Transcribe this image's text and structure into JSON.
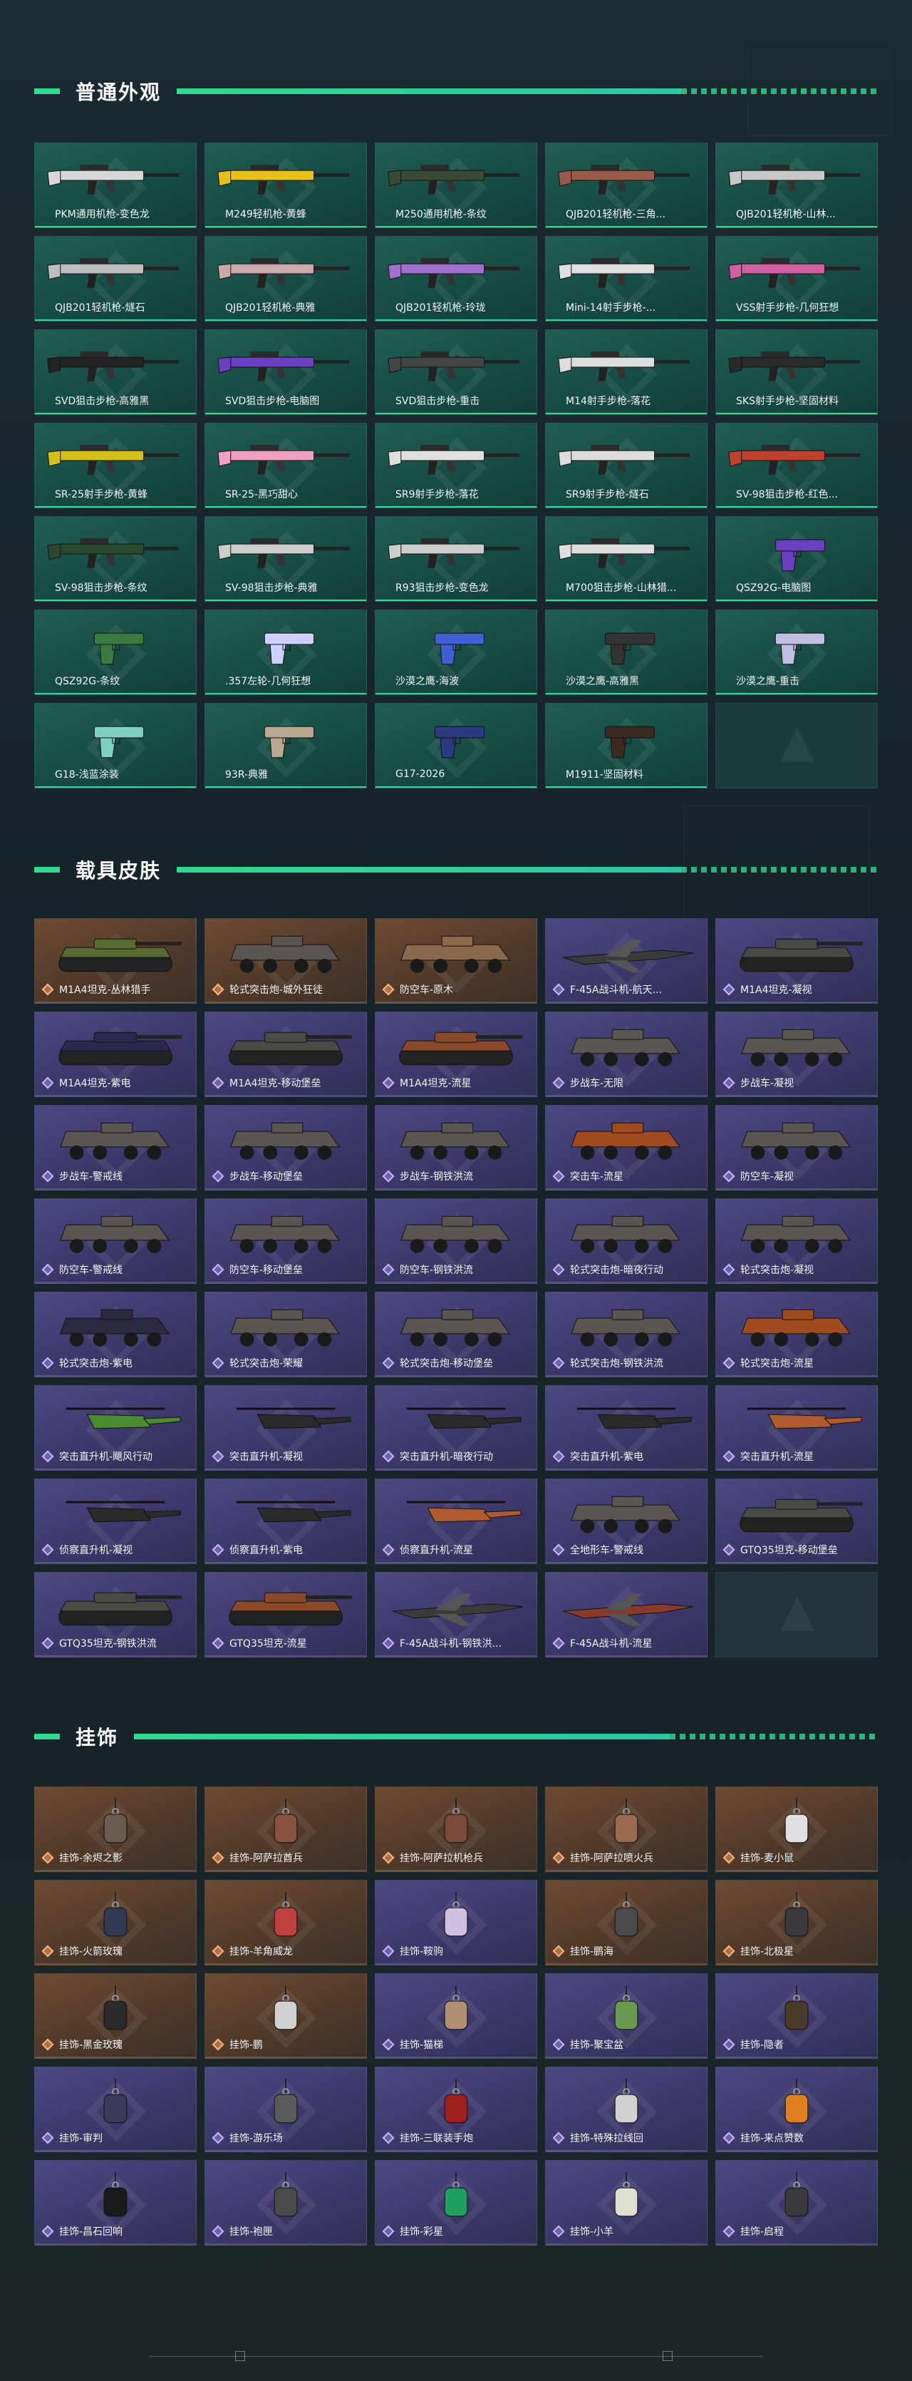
{
  "sections": {
    "weapons": {
      "title": "普通外观",
      "items": [
        "PKM通用机枪-变色龙",
        "M249轻机枪-黄蜂",
        "M250通用机枪-条纹",
        "QJB201轻机枪-三角...",
        "QJB201轻机枪-山林...",
        "QJB201轻机枪-燧石",
        "QJB201轻机枪-典雅",
        "QJB201轻机枪-玲珑",
        "Mini-14射手步枪-...",
        "VSS射手步枪-几何狂想",
        "SVD狙击步枪-高雅黑",
        "SVD狙击步枪-电脑图",
        "SVD狙击步枪-重击",
        "M14射手步枪-落花",
        "SKS射手步枪-坚固材料",
        "SR-25射手步枪-黄蜂",
        "SR-25-黑巧甜心",
        "SR9射手步枪-落花",
        "SR9射手步枪-燧石",
        "SV-98狙击步枪-红色...",
        "SV-98狙击步枪-条纹",
        "SV-98狙击步枪-典雅",
        "R93狙击步枪-变色龙",
        "M700狙击步枪-山林猎...",
        "QSZ92G-电脑图",
        "QSZ92G-条纹",
        ".357左轮-几何狂想",
        "沙漠之鹰-海波",
        "沙漠之鹰-高雅黑",
        "沙漠之鹰-重击",
        "G18-浅蓝涂装",
        "93R-典雅",
        "G17-2026",
        "M1911-坚固材料"
      ]
    },
    "vehicles": {
      "title": "载具皮肤",
      "items": [
        {
          "label": "M1A4坦克-丛林猎手",
          "tone": "orange"
        },
        {
          "label": "轮式突击炮-城外狂徒",
          "tone": "orange"
        },
        {
          "label": "防空车-原木",
          "tone": "orange"
        },
        {
          "label": "F-45A战斗机-航天...",
          "tone": "purple"
        },
        {
          "label": "M1A4坦克-凝视",
          "tone": "purple"
        },
        {
          "label": "M1A4坦克-紫电",
          "tone": "purple"
        },
        {
          "label": "M1A4坦克-移动堡垒",
          "tone": "purple"
        },
        {
          "label": "M1A4坦克-流星",
          "tone": "purple"
        },
        {
          "label": "步战车-无限",
          "tone": "purple"
        },
        {
          "label": "步战车-凝视",
          "tone": "purple"
        },
        {
          "label": "步战车-警戒线",
          "tone": "purple"
        },
        {
          "label": "步战车-移动堡垒",
          "tone": "purple"
        },
        {
          "label": "步战车-钢铁洪流",
          "tone": "purple"
        },
        {
          "label": "突击车-流星",
          "tone": "purple"
        },
        {
          "label": "防空车-凝视",
          "tone": "purple"
        },
        {
          "label": "防空车-警戒线",
          "tone": "purple"
        },
        {
          "label": "防空车-移动堡垒",
          "tone": "purple"
        },
        {
          "label": "防空车-钢铁洪流",
          "tone": "purple"
        },
        {
          "label": "轮式突击炮-暗夜行动",
          "tone": "purple"
        },
        {
          "label": "轮式突击炮-凝视",
          "tone": "purple"
        },
        {
          "label": "轮式突击炮-紫电",
          "tone": "purple"
        },
        {
          "label": "轮式突击炮-荣耀",
          "tone": "purple"
        },
        {
          "label": "轮式突击炮-移动堡垒",
          "tone": "purple"
        },
        {
          "label": "轮式突击炮-钢铁洪流",
          "tone": "purple"
        },
        {
          "label": "轮式突击炮-流星",
          "tone": "purple"
        },
        {
          "label": "突击直升机-飓风行动",
          "tone": "purple"
        },
        {
          "label": "突击直升机-凝视",
          "tone": "purple"
        },
        {
          "label": "突击直升机-暗夜行动",
          "tone": "purple"
        },
        {
          "label": "突击直升机-紫电",
          "tone": "purple"
        },
        {
          "label": "突击直升机-流星",
          "tone": "purple"
        },
        {
          "label": "侦察直升机-凝视",
          "tone": "purple"
        },
        {
          "label": "侦察直升机-紫电",
          "tone": "purple"
        },
        {
          "label": "侦察直升机-流星",
          "tone": "purple"
        },
        {
          "label": "全地形车-警戒线",
          "tone": "purple"
        },
        {
          "label": "GTQ35坦克-移动堡垒",
          "tone": "purple"
        },
        {
          "label": "GTQ35坦克-钢铁洪流",
          "tone": "purple"
        },
        {
          "label": "GTQ35坦克-流星",
          "tone": "purple"
        },
        {
          "label": "F-45A战斗机-钢铁洪...",
          "tone": "purple"
        },
        {
          "label": "F-45A战斗机-流星",
          "tone": "purple"
        }
      ]
    },
    "pendants": {
      "title": "挂饰",
      "items": [
        {
          "label": "挂饰-余烬之影",
          "tone": "orange"
        },
        {
          "label": "挂饰-阿萨拉酋兵",
          "tone": "orange"
        },
        {
          "label": "挂饰-阿萨拉机枪兵",
          "tone": "orange"
        },
        {
          "label": "挂饰-阿萨拉喷火兵",
          "tone": "orange"
        },
        {
          "label": "挂饰-麦小鼠",
          "tone": "orange"
        },
        {
          "label": "挂饰-火箭玫瑰",
          "tone": "orange"
        },
        {
          "label": "挂饰-羊角威龙",
          "tone": "orange"
        },
        {
          "label": "挂饰-鞍驹",
          "tone": "purple"
        },
        {
          "label": "挂饰-鹏海",
          "tone": "orange"
        },
        {
          "label": "挂饰-北极星",
          "tone": "orange"
        },
        {
          "label": "挂饰-黑金玫瑰",
          "tone": "orange"
        },
        {
          "label": "挂饰-鹏",
          "tone": "orange"
        },
        {
          "label": "挂饰-猫梯",
          "tone": "purple"
        },
        {
          "label": "挂饰-聚宝盆",
          "tone": "purple"
        },
        {
          "label": "挂饰-隐者",
          "tone": "purple"
        },
        {
          "label": "挂饰-审判",
          "tone": "purple"
        },
        {
          "label": "挂饰-游乐场",
          "tone": "purple"
        },
        {
          "label": "挂饰-三联装手炮",
          "tone": "purple"
        },
        {
          "label": "挂饰-特殊拉线回",
          "tone": "purple"
        },
        {
          "label": "挂饰-来点赞数",
          "tone": "purple"
        },
        {
          "label": "挂饰-昌石回响",
          "tone": "purple"
        },
        {
          "label": "挂饰-袍匣",
          "tone": "purple"
        },
        {
          "label": "挂饰-彩星",
          "tone": "purple"
        },
        {
          "label": "挂饰-小羊",
          "tone": "purple"
        },
        {
          "label": "挂饰-启程",
          "tone": "purple"
        }
      ]
    }
  },
  "colors": {
    "accent": "#2fd98f",
    "weapon_card": "#1f5e53",
    "vehicle_orange": "#6e4a33",
    "vehicle_purple": "#4d4883"
  }
}
